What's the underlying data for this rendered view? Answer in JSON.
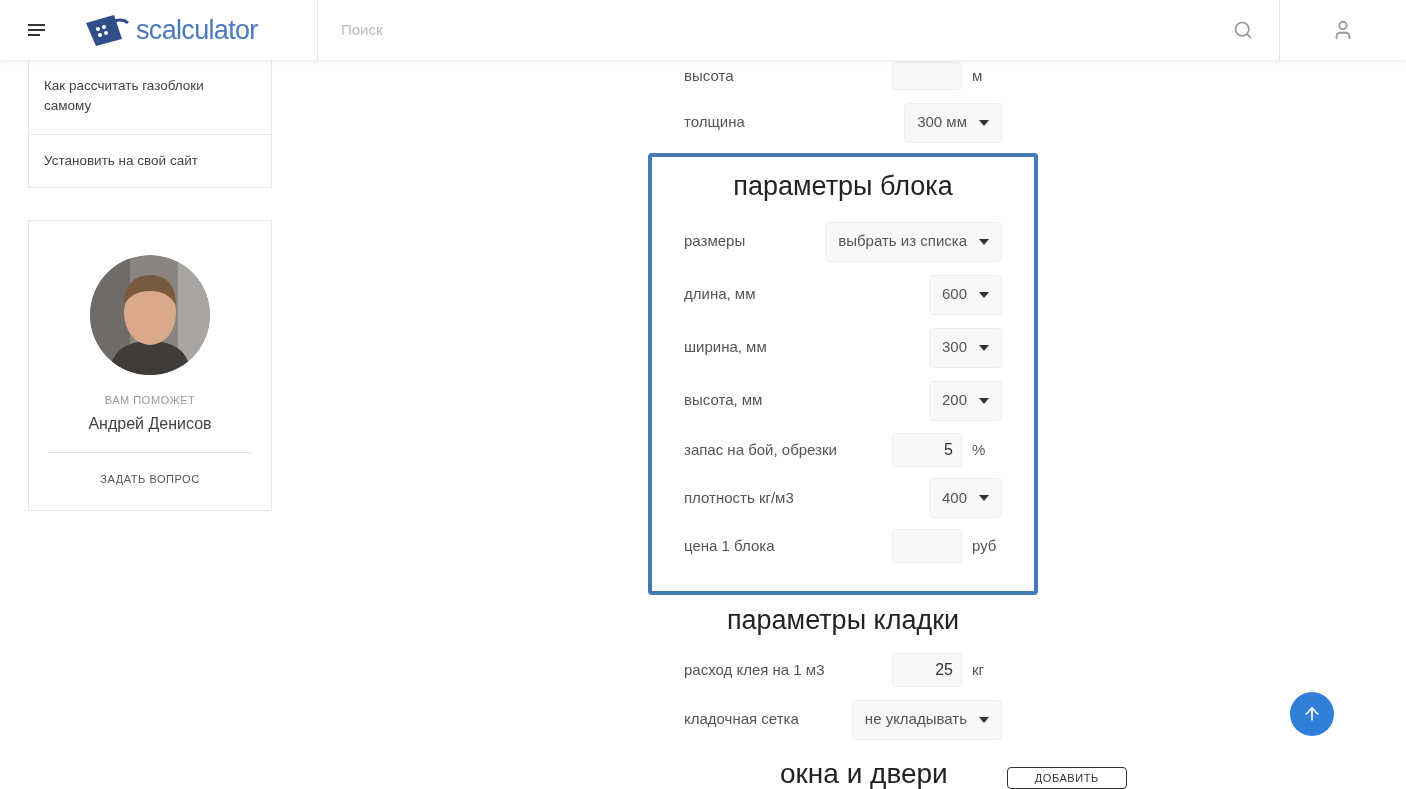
{
  "header": {
    "logo_text": "scalculator",
    "search_placeholder": "Поиск"
  },
  "sidebar": {
    "links": [
      "Как рассчитать газоблоки самому",
      "Установить на свой сайт"
    ],
    "helper": {
      "caption": "ВАМ ПОМОЖЕТ",
      "name": "Андрей Денисов",
      "action": "ЗАДАТЬ ВОПРОС"
    }
  },
  "sections": [
    {
      "boxed": false,
      "rows": [
        {
          "kind": "input",
          "label": "высота",
          "unit": "м"
        },
        {
          "kind": "select",
          "label": "толщина",
          "value": "300 мм"
        }
      ]
    },
    {
      "boxed": true,
      "title": "параметры блока",
      "rows": [
        {
          "kind": "select",
          "label": "размеры",
          "value": "выбрать из списка"
        },
        {
          "kind": "select",
          "label": "длина, мм",
          "value": "600"
        },
        {
          "kind": "select",
          "label": "ширина, мм",
          "value": "300"
        },
        {
          "kind": "select",
          "label": "высота, мм",
          "value": "200"
        },
        {
          "kind": "input",
          "label": "запас на бой, обрезки",
          "value": "5",
          "unit": "%"
        },
        {
          "kind": "select",
          "label": "плотность кг/м3",
          "value": "400"
        },
        {
          "kind": "input",
          "label": "цена 1 блока",
          "unit": "руб"
        }
      ]
    },
    {
      "boxed": false,
      "title": "параметры кладки",
      "rows": [
        {
          "kind": "input",
          "label": "расход клея на 1 м3",
          "value": "25",
          "unit": "кг"
        },
        {
          "kind": "select",
          "label": "кладочная сетка",
          "value": "не укладывать"
        }
      ]
    },
    {
      "boxed": false,
      "title": "окна и двери",
      "button": "ДОБАВИТЬ"
    }
  ]
}
